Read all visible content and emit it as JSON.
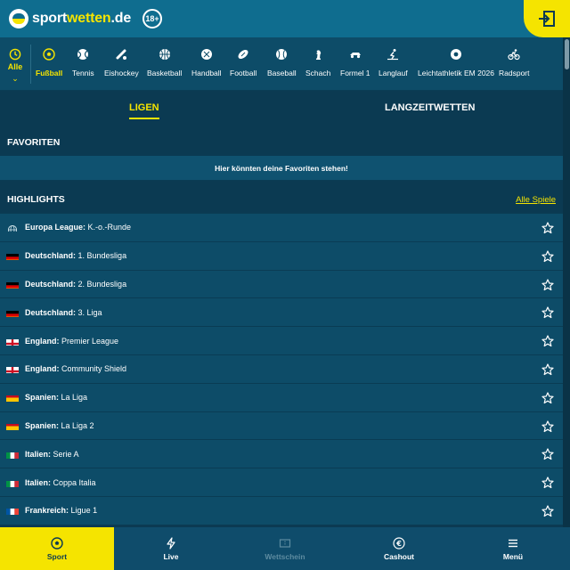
{
  "header": {
    "logo_part1": "sport",
    "logo_part2": "wetten",
    "logo_part3": ".de",
    "age_badge": "18+"
  },
  "sportnav": {
    "all_label": "Alle",
    "items": [
      {
        "label": "Fußball",
        "icon": "soccer-ball-icon",
        "active": true
      },
      {
        "label": "Tennis",
        "icon": "tennis-ball-icon"
      },
      {
        "label": "Eishockey",
        "icon": "hockey-icon"
      },
      {
        "label": "Basketball",
        "icon": "basketball-icon"
      },
      {
        "label": "Handball",
        "icon": "handball-icon"
      },
      {
        "label": "Football",
        "icon": "american-football-icon"
      },
      {
        "label": "Baseball",
        "icon": "baseball-icon"
      },
      {
        "label": "Schach",
        "icon": "chess-icon"
      },
      {
        "label": "Formel 1",
        "icon": "race-car-icon"
      },
      {
        "label": "Langlauf",
        "icon": "skiing-icon"
      },
      {
        "label": "Leichtathletik EM 2026",
        "icon": "athletics-icon"
      },
      {
        "label": "Radsport",
        "icon": "cycling-icon"
      }
    ]
  },
  "tabs": {
    "ligen": "LIGEN",
    "langzeit": "LANGZEITWETTEN"
  },
  "favoriten": {
    "title": "FAVORITEN",
    "empty_text": "Hier könnten deine Favoriten stehen!"
  },
  "highlights": {
    "title": "HIGHLIGHTS",
    "all_link": "Alle Spiele",
    "leagues": [
      {
        "country": "Europa League:",
        "league": "K.-o.-Runde",
        "flag": "globe"
      },
      {
        "country": "Deutschland:",
        "league": "1. Bundesliga",
        "flag": "de"
      },
      {
        "country": "Deutschland:",
        "league": "2. Bundesliga",
        "flag": "de"
      },
      {
        "country": "Deutschland:",
        "league": "3. Liga",
        "flag": "de"
      },
      {
        "country": "England:",
        "league": "Premier League",
        "flag": "en"
      },
      {
        "country": "England:",
        "league": "Community Shield",
        "flag": "en"
      },
      {
        "country": "Spanien:",
        "league": "La Liga",
        "flag": "es"
      },
      {
        "country": "Spanien:",
        "league": "La Liga 2",
        "flag": "es"
      },
      {
        "country": "Italien:",
        "league": "Serie A",
        "flag": "it"
      },
      {
        "country": "Italien:",
        "league": "Coppa Italia",
        "flag": "it"
      },
      {
        "country": "Frankreich:",
        "league": "Ligue 1",
        "flag": "fr"
      }
    ]
  },
  "bottombar": {
    "sport": "Sport",
    "live": "Live",
    "wettschein": "Wettschein",
    "cashout": "Cashout",
    "menu": "Menü"
  },
  "colors": {
    "accent": "#f5e400",
    "header_bg": "#0f6d8f",
    "page_bg": "#0b3a52"
  }
}
